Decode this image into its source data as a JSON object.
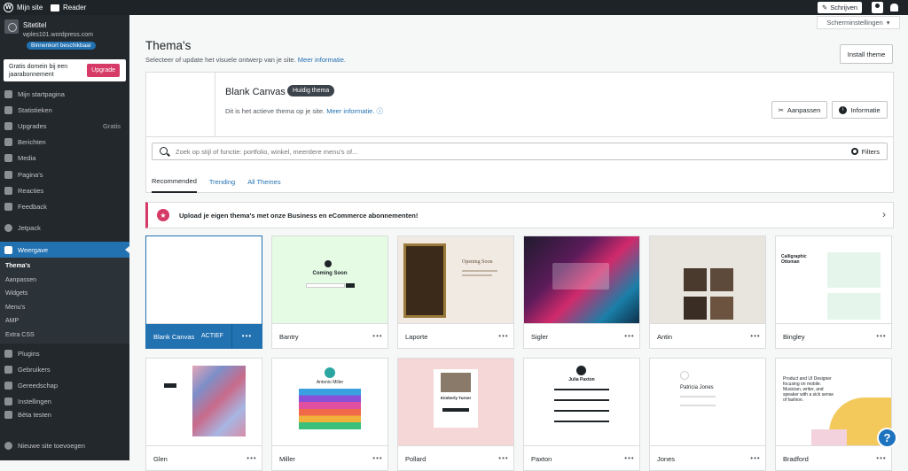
{
  "topbar": {
    "my_site": "Mijn site",
    "reader": "Reader",
    "write": "Schrijven"
  },
  "site": {
    "title": "Sitetitel",
    "url": "wples101.wordpress.com",
    "badge": "Binnenkort beschikbaar"
  },
  "upsell": {
    "text": "Gratis domein bij een jaarabonnement",
    "button": "Upgrade"
  },
  "menu": [
    {
      "label": "Mijn startpagina"
    },
    {
      "label": "Statistieken"
    },
    {
      "label": "Upgrades",
      "right": "Gratis"
    },
    {
      "label": "Berichten"
    },
    {
      "label": "Media"
    },
    {
      "label": "Pagina's"
    },
    {
      "label": "Reacties"
    },
    {
      "label": "Feedback"
    }
  ],
  "jetpack": "Jetpack",
  "weergave": "Weergave",
  "submenu": [
    "Thema's",
    "Aanpassen",
    "Widgets",
    "Menu's",
    "AMP",
    "Extra CSS"
  ],
  "menu2": [
    {
      "label": "Plugins"
    },
    {
      "label": "Gebruikers"
    },
    {
      "label": "Gereedschap"
    },
    {
      "label": "Instellingen"
    }
  ],
  "beta": "Bèta testen",
  "new_site": "Nieuwe site toevoegen",
  "screen_options": "Scherminstellingen",
  "page": {
    "title": "Thema's",
    "subtitle": "Selecteer of update het visuele ontwerp van je site.",
    "more_info": "Meer informatie.",
    "install": "Install theme"
  },
  "current_theme": {
    "name": "Blank Canvas",
    "badge": "Huidig thema",
    "desc": "Dit is het actieve thema op je site.",
    "more_info": "Meer informatie.",
    "customize": "Aanpassen",
    "info": "Informatie"
  },
  "search": {
    "placeholder": "Zoek op stijl of functie: portfolio, winkel, meerdere menu's of...",
    "filters": "Filters"
  },
  "tabs": [
    "Recommended",
    "Trending",
    "All Themes"
  ],
  "banner": "Upload je eigen thema's met onze Business en eCommerce abonnementen!",
  "themes": [
    {
      "name": "Blank Canvas",
      "active_label": "ACTIEF"
    },
    {
      "name": "Bantry",
      "preview": "Coming Soon"
    },
    {
      "name": "Laporte",
      "preview": "Opening Soon"
    },
    {
      "name": "Sigler"
    },
    {
      "name": "Antin"
    },
    {
      "name": "Bingley",
      "preview": "Calligraphic Ottoman"
    },
    {
      "name": "Glen"
    },
    {
      "name": "Miller",
      "preview": "Antonio Miller"
    },
    {
      "name": "Pollard",
      "preview": "Kimberly Turner"
    },
    {
      "name": "Paxton",
      "preview": "Julia Paxton"
    },
    {
      "name": "Jones",
      "preview": "Patricia Jones"
    },
    {
      "name": "Bradford",
      "preview": "Product and UI Designer focusing on mobile. Musician, writer, and speaker with a sick sense of fashion."
    }
  ],
  "colors": {
    "sidebar": "#23282d",
    "accent": "#2271b1",
    "pink": "#d63a66"
  }
}
